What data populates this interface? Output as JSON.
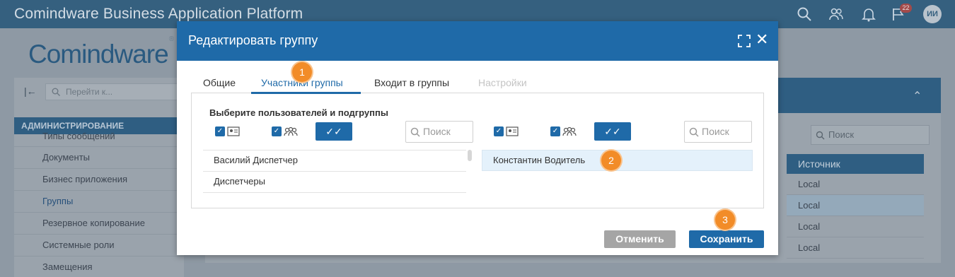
{
  "app": {
    "title": "Comindware Business Application Platform",
    "avatar_initials": "ИИ",
    "notifications_badge": "22"
  },
  "logo": {
    "text": "Comindware",
    "mark": "®"
  },
  "sidebar": {
    "search_placeholder": "Перейти к...",
    "section_header": "АДМИНИСТРИРОВАНИЕ",
    "items": [
      {
        "label": "Типы сообщений"
      },
      {
        "label": "Документы"
      },
      {
        "label": "Бизнес приложения"
      },
      {
        "label": "Группы"
      },
      {
        "label": "Резервное копирование"
      },
      {
        "label": "Системные роли"
      },
      {
        "label": "Замещения"
      }
    ]
  },
  "right_panel": {
    "search_placeholder": "Поиск",
    "column_header": "Источник",
    "cells": [
      "Local",
      "Local",
      "Local",
      "Local"
    ]
  },
  "modal": {
    "title": "Редактировать группу",
    "tabs": [
      {
        "label": "Общие",
        "state": "normal"
      },
      {
        "label": "Участники группы",
        "state": "active"
      },
      {
        "label": "Входит в группы",
        "state": "normal"
      },
      {
        "label": "Настройки",
        "state": "disabled"
      }
    ],
    "select_label": "Выберите пользователей и подгруппы",
    "left_search_placeholder": "Поиск",
    "right_search_placeholder": "Поиск",
    "left_list": [
      "Василий Диспетчер",
      "Диспетчеры"
    ],
    "right_list": [
      "Константин Водитель"
    ],
    "cancel_label": "Отменить",
    "save_label": "Сохранить"
  },
  "steps": [
    "1",
    "2",
    "3"
  ],
  "colors": {
    "primary": "#1f6aa8",
    "topbar": "#35607f",
    "step": "#f28c28",
    "cancel": "#a5a5a5"
  }
}
